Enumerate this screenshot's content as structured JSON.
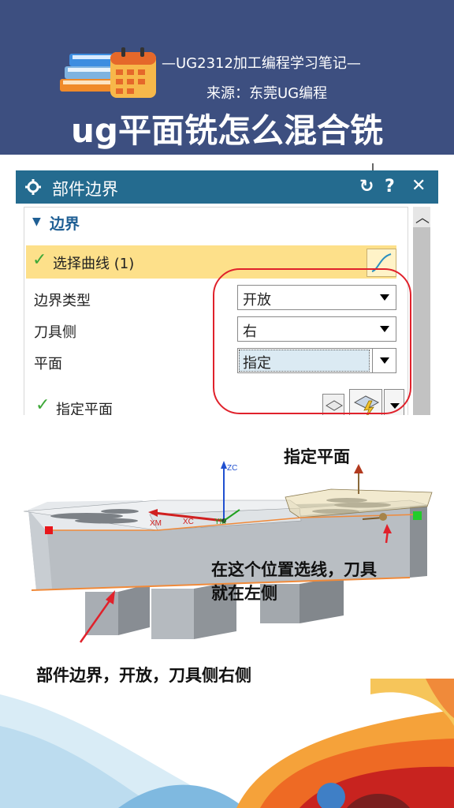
{
  "header": {
    "series": "—UG2312加工编程学习笔记—",
    "source": "来源：东莞UG编程",
    "title": "ug平面铣怎么混合铣"
  },
  "dialog": {
    "title": "部件边界",
    "titlebar_icons": [
      "gear-icon",
      "reset-icon",
      "help-icon",
      "close-icon"
    ],
    "section": "边界",
    "select_curve": "选择曲线 (1)",
    "rows": [
      {
        "label": "边界类型",
        "value": "开放"
      },
      {
        "label": "刀具侧",
        "value": "右"
      },
      {
        "label": "平面",
        "value": "指定"
      }
    ],
    "specify_plane": "指定平面"
  },
  "viewport": {
    "axis_labels": {
      "zc": "ZC",
      "xm": "XM",
      "xc": "XC",
      "ym": "YM"
    }
  },
  "annotations": {
    "specify_plane": "指定平面",
    "select_line_line1": "在这个位置选线，刀具",
    "select_line_line2": "就在左侧",
    "boundary_note": "部件边界，开放，刀具侧右侧"
  },
  "colors": {
    "banner": "#3d4f80",
    "titlebar": "#246b8f",
    "highlight": "#fde08a",
    "annotation_red": "#e0212b"
  }
}
